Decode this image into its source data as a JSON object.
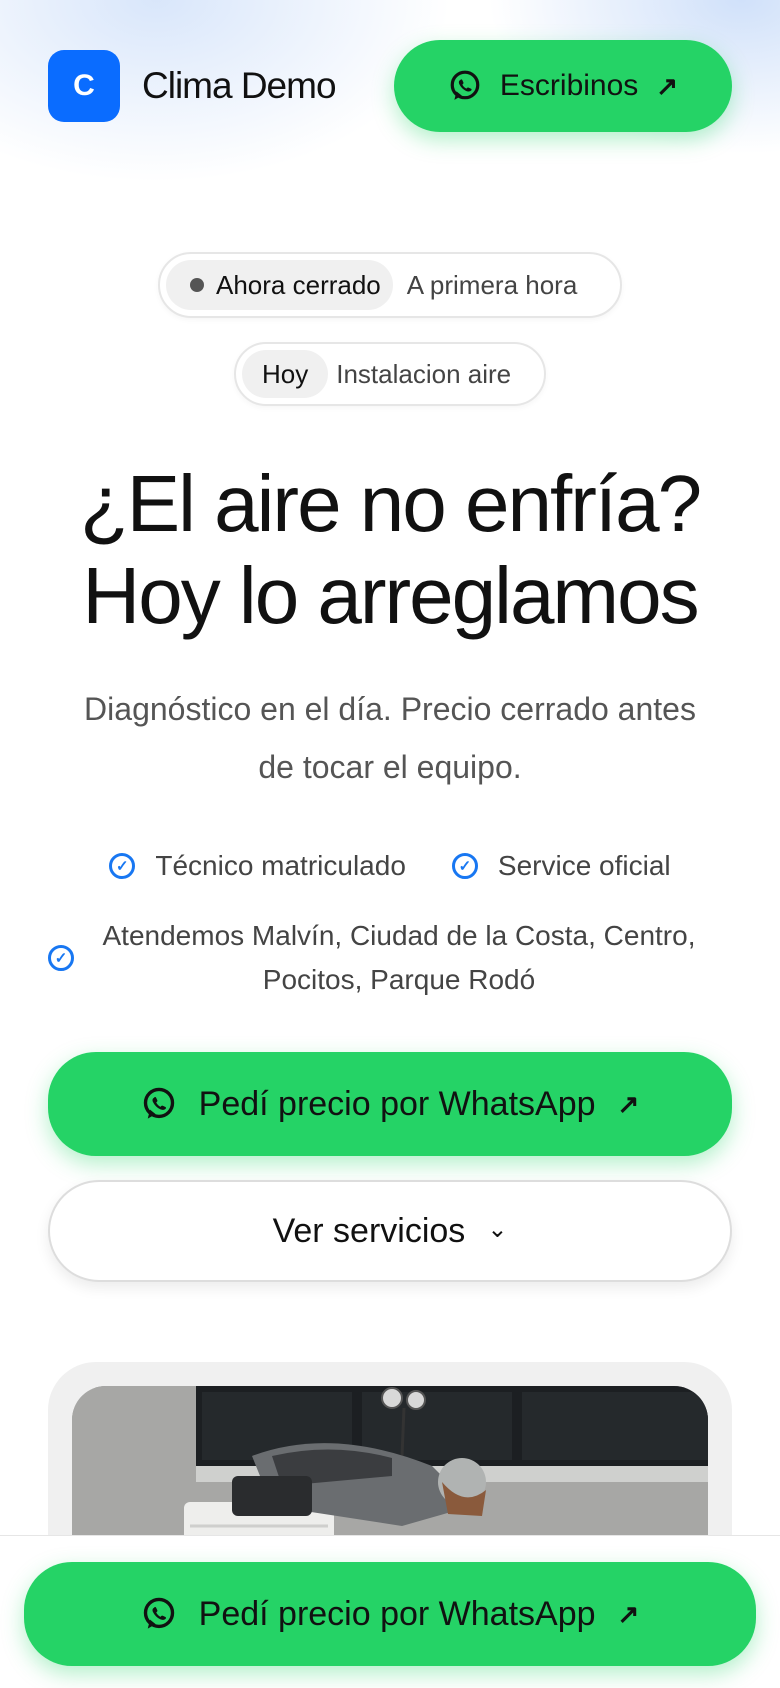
{
  "brand": {
    "logo_letter": "C",
    "name": "Clima Demo"
  },
  "header": {
    "cta_label": "Escribinos"
  },
  "status": {
    "badge": "Ahora cerrado",
    "note": "A primera hora"
  },
  "today": {
    "badge": "Hoy",
    "note": "Instalacion aire"
  },
  "hero": {
    "title_line1": "¿El aire no enfría?",
    "title_line2": "Hoy lo arreglamos",
    "subtitle": "Diagnóstico en el día. Precio cerrado antes de tocar el equipo."
  },
  "checks": {
    "items": [
      "Técnico matriculado",
      "Service oficial"
    ],
    "area": "Atendemos Malvín, Ciudad de la Costa, Centro, Pocitos, Parque Rodó"
  },
  "cta": {
    "whatsapp_label": "Pedí precio por WhatsApp",
    "services_label": "Ver servicios"
  },
  "sticky": {
    "whatsapp_label": "Pedí precio por WhatsApp"
  },
  "colors": {
    "brand_blue": "#0a6cff",
    "whatsapp_green": "#25d366",
    "check_blue": "#1877f2"
  },
  "icons": [
    "whatsapp-icon",
    "arrow-up-right-icon",
    "check-circle-icon",
    "chevron-down-icon",
    "status-dot-icon"
  ]
}
